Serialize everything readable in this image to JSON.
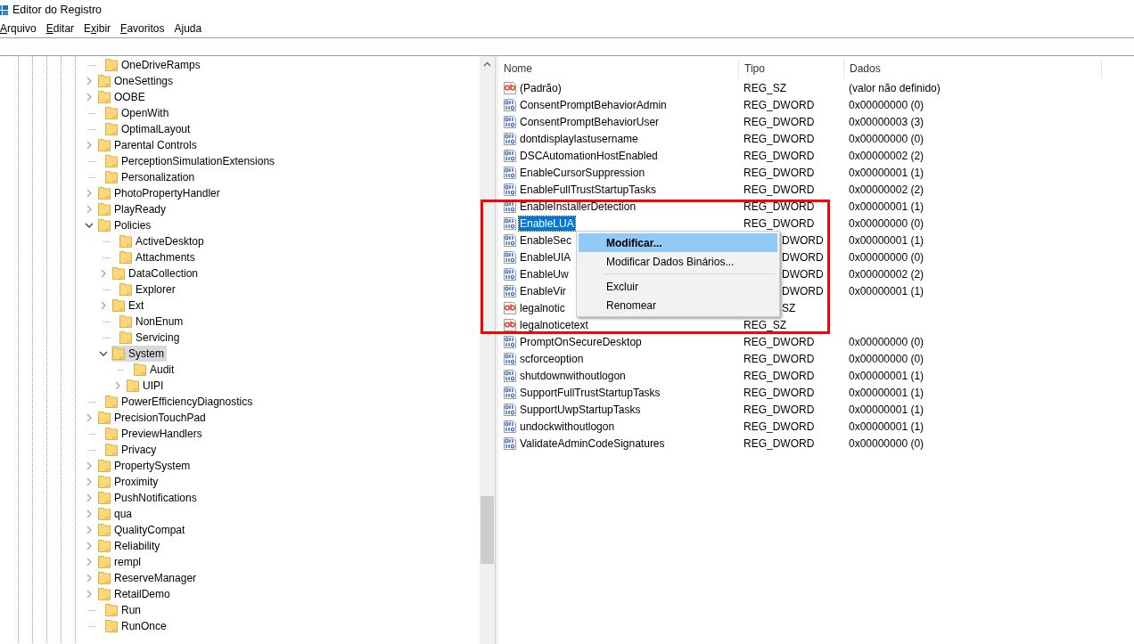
{
  "window": {
    "title": "Editor do Registro"
  },
  "menu_bar": [
    {
      "key": "A",
      "after": "rquivo"
    },
    {
      "key": "E",
      "after": "ditar"
    },
    {
      "before": "E",
      "key": "x",
      "after": "ibir"
    },
    {
      "key": "F",
      "after": "avoritos"
    },
    {
      "before": "A",
      "key": "j",
      "after": "uda"
    }
  ],
  "tree": [
    {
      "label": "OneDriveRamps",
      "expandable": false,
      "selected": false
    },
    {
      "label": "OneSettings",
      "expandable": true,
      "expanded": false,
      "selected": false
    },
    {
      "label": "OOBE",
      "expandable": true,
      "expanded": false,
      "selected": false
    },
    {
      "label": "OpenWith",
      "expandable": false,
      "selected": false
    },
    {
      "label": "OptimalLayout",
      "expandable": false,
      "selected": false
    },
    {
      "label": "Parental Controls",
      "expandable": true,
      "expanded": false,
      "selected": false
    },
    {
      "label": "PerceptionSimulationExtensions",
      "expandable": false,
      "selected": false
    },
    {
      "label": "Personalization",
      "expandable": false,
      "selected": false
    },
    {
      "label": "PhotoPropertyHandler",
      "expandable": true,
      "expanded": false,
      "selected": false
    },
    {
      "label": "PlayReady",
      "expandable": true,
      "expanded": false,
      "selected": false
    },
    {
      "label": "Policies",
      "expandable": true,
      "expanded": true,
      "selected": false,
      "children": [
        {
          "label": "ActiveDesktop",
          "expandable": false,
          "selected": false
        },
        {
          "label": "Attachments",
          "expandable": false,
          "selected": false
        },
        {
          "label": "DataCollection",
          "expandable": true,
          "expanded": false,
          "selected": false
        },
        {
          "label": "Explorer",
          "expandable": false,
          "selected": false
        },
        {
          "label": "Ext",
          "expandable": true,
          "expanded": false,
          "selected": false
        },
        {
          "label": "NonEnum",
          "expandable": false,
          "selected": false
        },
        {
          "label": "Servicing",
          "expandable": false,
          "selected": false
        },
        {
          "label": "System",
          "expandable": true,
          "expanded": true,
          "selected": true,
          "children": [
            {
              "label": "Audit",
              "expandable": false,
              "selected": false
            },
            {
              "label": "UIPI",
              "expandable": true,
              "expanded": false,
              "selected": false
            }
          ]
        }
      ]
    },
    {
      "label": "PowerEfficiencyDiagnostics",
      "expandable": false,
      "selected": false
    },
    {
      "label": "PrecisionTouchPad",
      "expandable": true,
      "expanded": false,
      "selected": false
    },
    {
      "label": "PreviewHandlers",
      "expandable": false,
      "selected": false
    },
    {
      "label": "Privacy",
      "expandable": false,
      "selected": false
    },
    {
      "label": "PropertySystem",
      "expandable": true,
      "expanded": false,
      "selected": false
    },
    {
      "label": "Proximity",
      "expandable": true,
      "expanded": false,
      "selected": false
    },
    {
      "label": "PushNotifications",
      "expandable": true,
      "expanded": false,
      "selected": false
    },
    {
      "label": "qua",
      "expandable": true,
      "expanded": false,
      "selected": false
    },
    {
      "label": "QualityCompat",
      "expandable": true,
      "expanded": false,
      "selected": false
    },
    {
      "label": "Reliability",
      "expandable": true,
      "expanded": false,
      "selected": false
    },
    {
      "label": "rempl",
      "expandable": true,
      "expanded": false,
      "selected": false
    },
    {
      "label": "ReserveManager",
      "expandable": true,
      "expanded": false,
      "selected": false
    },
    {
      "label": "RetailDemo",
      "expandable": true,
      "expanded": false,
      "selected": false
    },
    {
      "label": "Run",
      "expandable": false,
      "selected": false
    },
    {
      "label": "RunOnce",
      "expandable": false,
      "selected": false
    }
  ],
  "values_table": {
    "columns": [
      "Nome",
      "Tipo",
      "Dados"
    ],
    "rows": [
      {
        "kind": "string",
        "name": "(Padrão)",
        "type": "REG_SZ",
        "data": "(valor não definido)",
        "selected": false,
        "covered": false
      },
      {
        "kind": "binary",
        "name": "ConsentPromptBehaviorAdmin",
        "type": "REG_DWORD",
        "data": "0x00000000 (0)",
        "selected": false,
        "covered": false
      },
      {
        "kind": "binary",
        "name": "ConsentPromptBehaviorUser",
        "type": "REG_DWORD",
        "data": "0x00000003 (3)",
        "selected": false,
        "covered": false
      },
      {
        "kind": "binary",
        "name": "dontdisplaylastusername",
        "type": "REG_DWORD",
        "data": "0x00000000 (0)",
        "selected": false,
        "covered": false
      },
      {
        "kind": "binary",
        "name": "DSCAutomationHostEnabled",
        "type": "REG_DWORD",
        "data": "0x00000002 (2)",
        "selected": false,
        "covered": false
      },
      {
        "kind": "binary",
        "name": "EnableCursorSuppression",
        "type": "REG_DWORD",
        "data": "0x00000001 (1)",
        "selected": false,
        "covered": false
      },
      {
        "kind": "binary",
        "name": "EnableFullTrustStartupTasks",
        "type": "REG_DWORD",
        "data": "0x00000002 (2)",
        "selected": false,
        "covered": false
      },
      {
        "kind": "binary",
        "name": "EnableInstallerDetection",
        "type": "REG_DWORD",
        "data": "0x00000001 (1)",
        "selected": false,
        "covered": false
      },
      {
        "kind": "binary",
        "name": "EnableLUA",
        "type": "REG_DWORD",
        "data": "0x00000000 (0)",
        "selected": true,
        "covered": false
      },
      {
        "kind": "binary",
        "name": "EnableSec",
        "type": "DWORD",
        "data": "0x00000001 (1)",
        "selected": false,
        "covered": true
      },
      {
        "kind": "binary",
        "name": "EnableUIA",
        "type": "DWORD",
        "data": "0x00000000 (0)",
        "selected": false,
        "covered": true
      },
      {
        "kind": "binary",
        "name": "EnableUw",
        "type": "DWORD",
        "data": "0x00000002 (2)",
        "selected": false,
        "covered": true
      },
      {
        "kind": "binary",
        "name": "EnableVir",
        "type": "DWORD",
        "data": "0x00000001 (1)",
        "selected": false,
        "covered": true
      },
      {
        "kind": "string",
        "name": "legalnotic",
        "type": "SZ",
        "selected": false,
        "covered": true
      },
      {
        "kind": "string",
        "name": "legalnoticetext",
        "type": "REG_SZ",
        "selected": false,
        "covered": false
      },
      {
        "kind": "binary",
        "name": "PromptOnSecureDesktop",
        "type": "REG_DWORD",
        "data": "0x00000000 (0)",
        "selected": false,
        "covered": false
      },
      {
        "kind": "binary",
        "name": "scforceoption",
        "type": "REG_DWORD",
        "data": "0x00000000 (0)",
        "selected": false,
        "covered": false
      },
      {
        "kind": "binary",
        "name": "shutdownwithoutlogon",
        "type": "REG_DWORD",
        "data": "0x00000001 (1)",
        "selected": false,
        "covered": false
      },
      {
        "kind": "binary",
        "name": "SupportFullTrustStartupTasks",
        "type": "REG_DWORD",
        "data": "0x00000001 (1)",
        "selected": false,
        "covered": false
      },
      {
        "kind": "binary",
        "name": "SupportUwpStartupTasks",
        "type": "REG_DWORD",
        "data": "0x00000001 (1)",
        "selected": false,
        "covered": false
      },
      {
        "kind": "binary",
        "name": "undockwithoutlogon",
        "type": "REG_DWORD",
        "data": "0x00000001 (1)",
        "selected": false,
        "covered": false
      },
      {
        "kind": "binary",
        "name": "ValidateAdminCodeSignatures",
        "type": "REG_DWORD",
        "data": "0x00000000 (0)",
        "selected": false,
        "covered": false
      }
    ]
  },
  "context_menu": [
    {
      "kind": "item",
      "label": "Modificar...",
      "selected": true,
      "default": true
    },
    {
      "kind": "item",
      "label": "Modificar Dados Binários...",
      "selected": false,
      "default": false
    },
    {
      "kind": "separator"
    },
    {
      "kind": "item",
      "label": "Excluir",
      "selected": false,
      "default": false
    },
    {
      "kind": "item",
      "label": "Renomear",
      "selected": false,
      "default": false
    }
  ]
}
